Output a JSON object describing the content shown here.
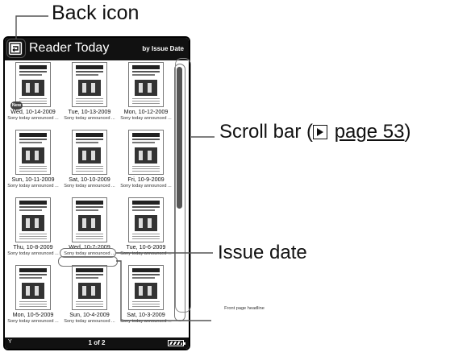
{
  "callouts": {
    "back_icon": "Back icon",
    "scroll_bar_prefix": "Scroll bar (",
    "scroll_bar_page_link": "page 53",
    "scroll_bar_suffix": ")",
    "issue_date": "Issue date",
    "front_page_headline": "Front page headline"
  },
  "screen": {
    "title": "Reader Today",
    "sort_label": "by Issue Date",
    "new_badge": "New",
    "footer": {
      "page_indicator": "1 of 2",
      "signal_label": "Y"
    },
    "scroll_position": 0.5,
    "issues": [
      {
        "date": "Wed, 10-14-2009",
        "headline": "Sony today announced ...",
        "is_new": true
      },
      {
        "date": "Tue, 10-13-2009",
        "headline": "Sony today announced ...",
        "is_new": false
      },
      {
        "date": "Mon, 10-12-2009",
        "headline": "Sony today announced ...",
        "is_new": false
      },
      {
        "date": "Sun, 10-11-2009",
        "headline": "Sony today announced ...",
        "is_new": false
      },
      {
        "date": "Sat, 10-10-2009",
        "headline": "Sony today announced ...",
        "is_new": false
      },
      {
        "date": "Fri, 10-9-2009",
        "headline": "Sony today announced ...",
        "is_new": false
      },
      {
        "date": "Thu, 10-8-2009",
        "headline": "Sony today announced ...",
        "is_new": false
      },
      {
        "date": "Wed, 10-7-2009",
        "headline": "Sony today announced ...",
        "is_new": false
      },
      {
        "date": "Tue, 10-6-2009",
        "headline": "Sony today announced ...",
        "is_new": false
      },
      {
        "date": "Mon, 10-5-2009",
        "headline": "Sony today announced ...",
        "is_new": false
      },
      {
        "date": "Sun, 10-4-2009",
        "headline": "Sony today announced ...",
        "is_new": false
      },
      {
        "date": "Sat, 10-3-2009",
        "headline": "Sony today announced ...",
        "is_new": false
      }
    ]
  },
  "colors": {
    "titlebar": "#111111",
    "callout_line": "#555555"
  }
}
